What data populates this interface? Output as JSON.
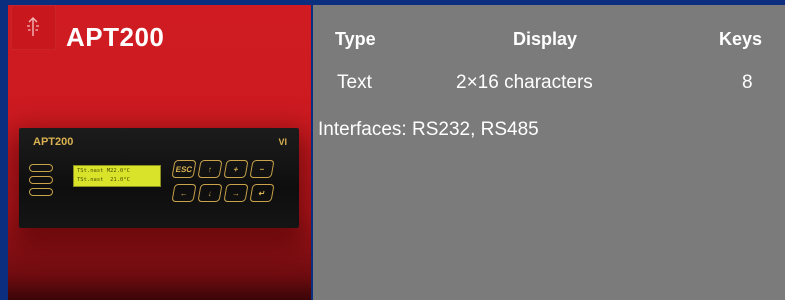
{
  "product": {
    "name": "APT200",
    "logo_icon": "antenna-arrow-icon"
  },
  "device_image": {
    "brand": "APT200",
    "maker_logo": "VI",
    "lcd_lines": [
      "TSt.nast M22.0°C",
      "TSt.nast  21.0°C"
    ],
    "keys": [
      "ESC",
      "↑",
      "+",
      "−",
      "←",
      "↓",
      "→",
      "↵"
    ]
  },
  "specs": {
    "headers": {
      "type": "Type",
      "display": "Display",
      "keys": "Keys"
    },
    "values": {
      "type": "Text",
      "display": "2×16 characters",
      "keys": "8"
    },
    "interfaces": "Interfaces: RS232, RS485"
  },
  "colors": {
    "background": "#0b2f7e",
    "left_panel": "#d01b22",
    "right_panel": "#7b7b7b",
    "text": "#ffffff",
    "device_accent": "#d9b150",
    "lcd": "#d8e32a"
  }
}
